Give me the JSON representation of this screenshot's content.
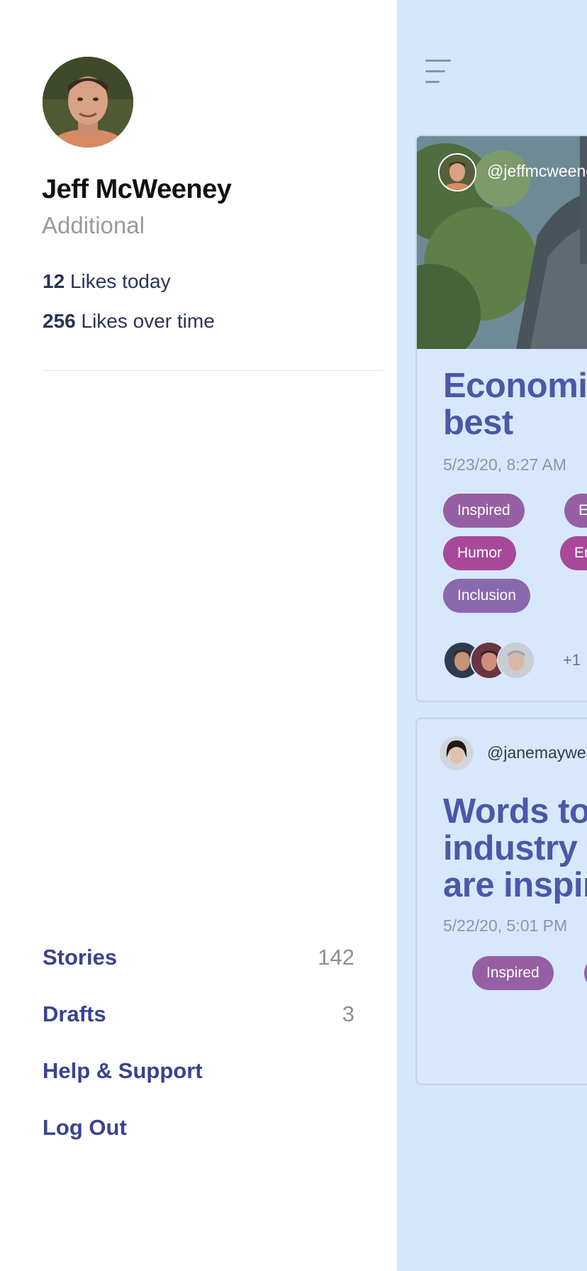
{
  "profile": {
    "name": "Jeff McWeeney",
    "subtitle": "Additional",
    "stats": [
      {
        "value": "12",
        "label": "Likes today"
      },
      {
        "value": "256",
        "label": "Likes over time"
      }
    ]
  },
  "menu": [
    {
      "label": "Stories",
      "count": "142"
    },
    {
      "label": "Drafts",
      "count": "3"
    },
    {
      "label": "Help & Support"
    },
    {
      "label": "Log Out"
    }
  ],
  "feed": {
    "cards": [
      {
        "handle": "@jeffmcweeney",
        "title": "Economics at its best",
        "date": "5/23/20, 8:27 AM",
        "tags": [
          "Inspired",
          "E",
          "Humor",
          "En",
          "Inclusion"
        ],
        "likers_more": "+1"
      },
      {
        "handle": "@janemayweather",
        "title": "Words to the industry that are inspiring",
        "date": "5/22/20, 5:01 PM",
        "tags": [
          "Inspired",
          "E"
        ]
      }
    ]
  },
  "colors": {
    "feed_background": "#d5e7fd",
    "menu_text": "#3a4290",
    "title_text": "#4c57a8",
    "tag_inspired": "#975fa3",
    "tag_humor": "#a9479b",
    "tag_inclusion": "#8b68ad"
  },
  "icons": [
    "menu-icon"
  ]
}
